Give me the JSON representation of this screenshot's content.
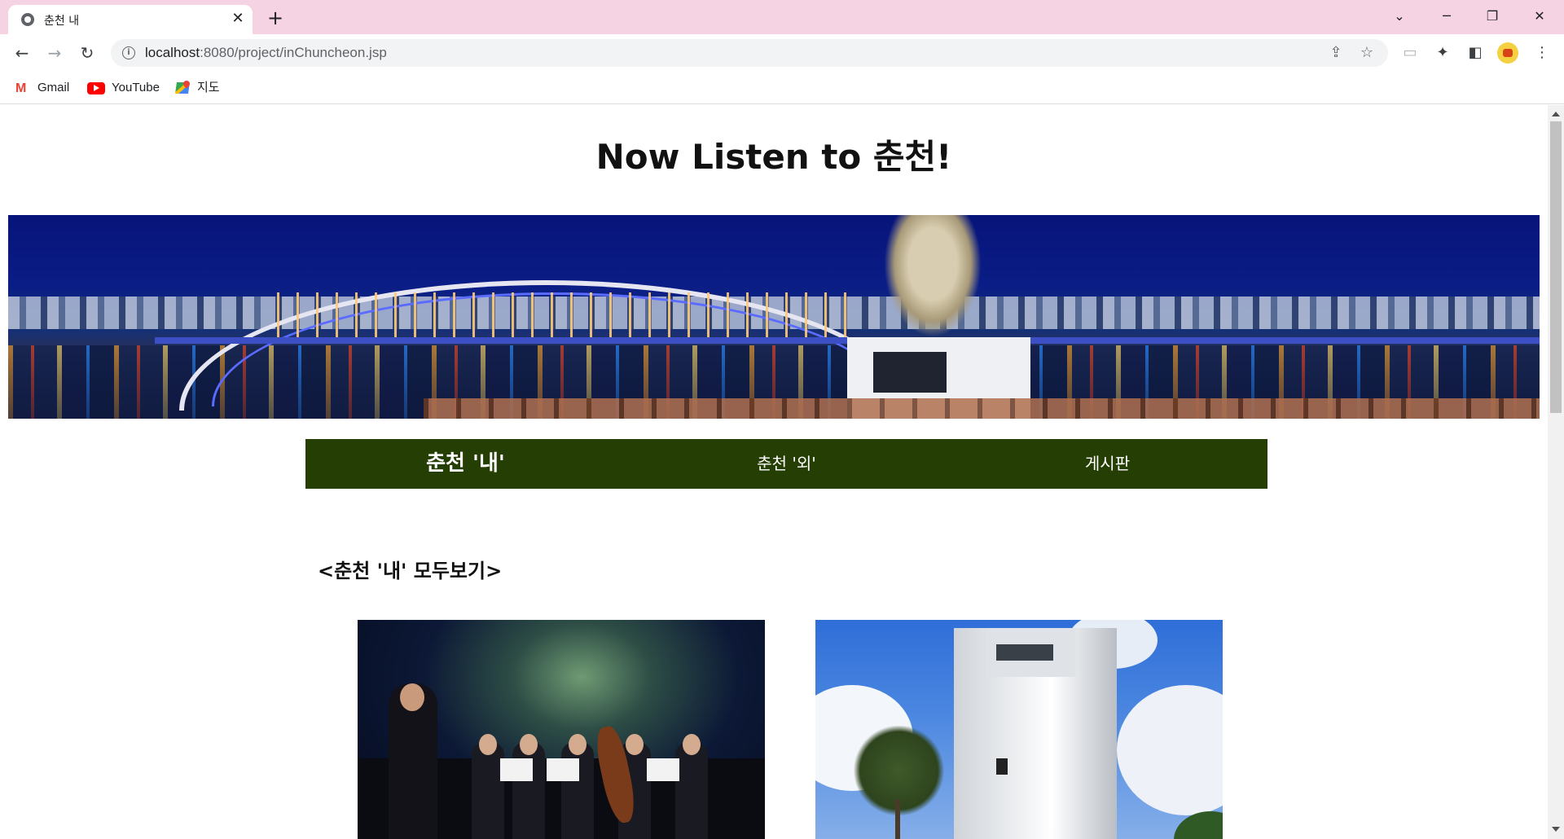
{
  "browser": {
    "tab_title": "춘천 내",
    "url_host": "localhost",
    "url_rest": ":8080/project/inChuncheon.jsp",
    "new_tab_symbol": "+",
    "close_symbol": "✕",
    "bookmarks": [
      {
        "label": "Gmail",
        "icon": "gmail-icon"
      },
      {
        "label": "YouTube",
        "icon": "youtube-icon"
      },
      {
        "label": "지도",
        "icon": "maps-icon"
      }
    ]
  },
  "page": {
    "title": "Now Listen to 춘천!",
    "menu": [
      {
        "label": "춘천 '내'",
        "active": true
      },
      {
        "label": "춘천 '외'",
        "active": false
      },
      {
        "label": "게시판",
        "active": false
      }
    ],
    "section_title": "<춘천 '내' 모두보기>",
    "colors": {
      "menu_bg": "#253e03",
      "tabbar_bg": "#f6d3e3"
    }
  }
}
